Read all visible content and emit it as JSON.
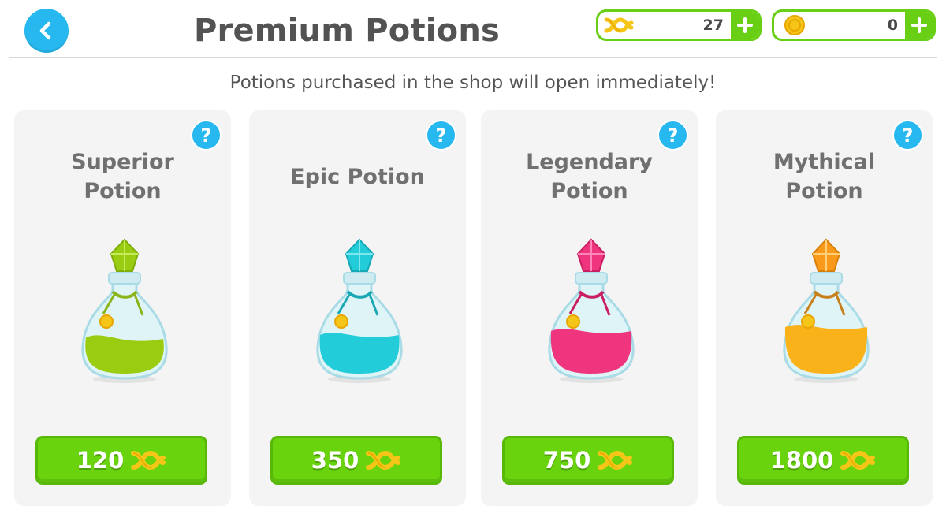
{
  "header": {
    "title": "Premium Potions",
    "back_icon": "chevron-left-icon"
  },
  "currencies": {
    "dna": {
      "value": "27",
      "icon": "dna-icon",
      "add_icon": "plus-icon"
    },
    "coins": {
      "value": "0",
      "icon": "coin-icon",
      "add_icon": "plus-icon"
    }
  },
  "subtitle": "Potions purchased in the shop will open immediately!",
  "potions": [
    {
      "name": "Superior Potion",
      "price": "120",
      "color": "#9acd12",
      "icon": "green-potion-icon"
    },
    {
      "name": "Epic Potion",
      "price": "350",
      "color": "#22ccd8",
      "icon": "cyan-potion-icon"
    },
    {
      "name": "Legendary Potion",
      "price": "750",
      "color": "#f0357f",
      "icon": "pink-potion-icon"
    },
    {
      "name": "Mythical Potion",
      "price": "1800",
      "color": "#f9b21a",
      "icon": "orange-potion-icon"
    }
  ],
  "help_label": "?",
  "colors": {
    "accent_blue": "#26b8ee",
    "button_green": "#69d40e"
  }
}
